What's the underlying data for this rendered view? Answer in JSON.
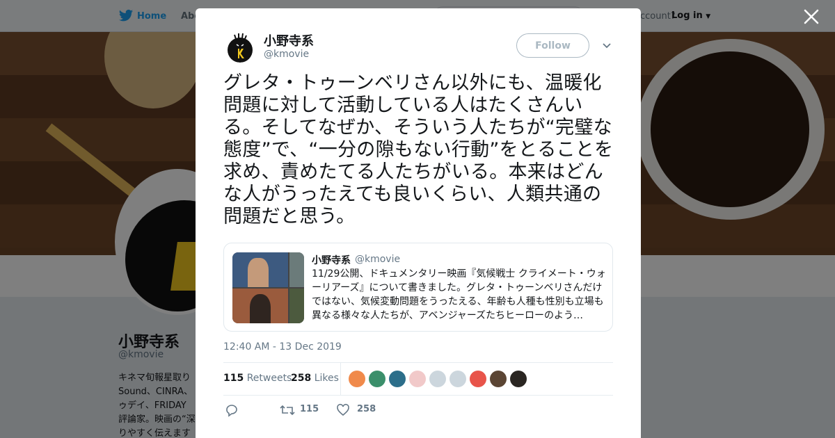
{
  "topbar": {
    "home_label": "Home",
    "about_label": "Abo",
    "account_text": "account?",
    "login_label": "Log in"
  },
  "profile": {
    "name": "小野寺系",
    "handle": "@kmovie",
    "bio_lines": "キネマ旬報星取り\nSound、CINRA、\nゥデイ、FRIDAY\n評論家。映画の“深\nりやすく伝えます"
  },
  "modal": {
    "author_name": "小野寺系",
    "author_handle": "@kmovie",
    "follow_label": "Follow",
    "tweet_text": "グレタ・トゥーンベリさん以外にも、温暖化問題に対して活動している人はたくさんいる。そしてなぜか、そういう人たちが“完璧な態度”で、“一分の隙もない行動”をとることを求め、責めたてる人たちがいる。本来はどんな人がうったえても良いくらい、人類共通の問題だと思う。",
    "quoted": {
      "name": "小野寺系",
      "handle": "@kmovie",
      "text": "11/29公開、ドキュメンタリー映画『気候戦士 クライメート・ウォーリアーズ』について書きました。グレタ・トゥーンベリさんだけではない、気候変動問題をうったえる、年齢も人種も性別も立場も異なる様々な人たちが、アベンジャーズたちヒーローのよう…"
    },
    "timestamp": "12:40 AM - 13 Dec 2019",
    "stats": {
      "retweets_count": "115",
      "retweets_label": "Retweets",
      "likes_count": "258",
      "likes_label": "Likes"
    },
    "likers": [
      {
        "color": "#f08a4b"
      },
      {
        "color": "#3b8f6b"
      },
      {
        "color": "#2c6e8a"
      },
      {
        "color": "#f1c9c9"
      },
      {
        "color": "#ccd6dd"
      },
      {
        "color": "#ccd6dd"
      },
      {
        "color": "#e8544a"
      },
      {
        "color": "#5b4534"
      },
      {
        "color": "#2a2622"
      }
    ],
    "actions": {
      "retweet_count": "115",
      "like_count": "258"
    }
  },
  "colors": {
    "accent": "#1da1f2",
    "text_primary": "#14171a",
    "text_secondary": "#657786",
    "border": "#e6ecf0"
  },
  "icons": {
    "logo": "bird-icon",
    "close": "close-icon",
    "caret": "chevron-down-icon",
    "reply": "reply-icon",
    "retweet": "retweet-icon",
    "like": "heart-icon"
  }
}
